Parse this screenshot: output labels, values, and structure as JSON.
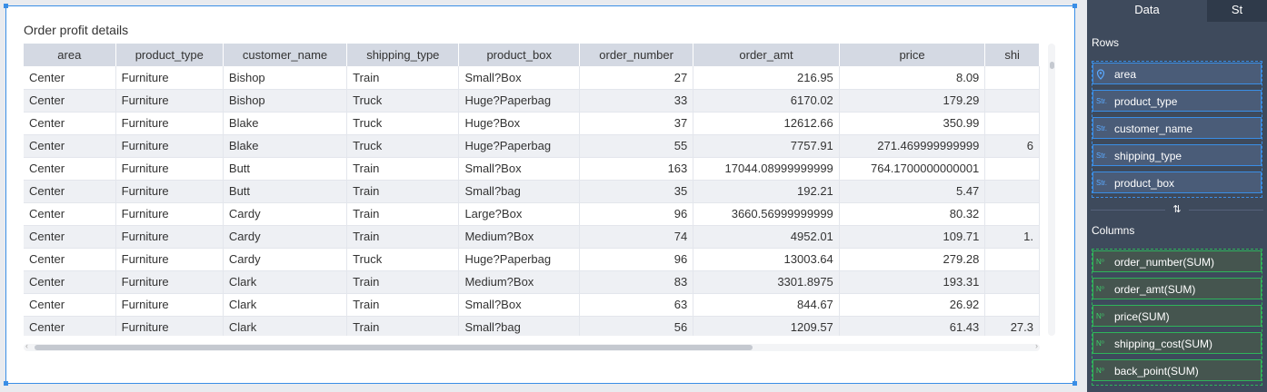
{
  "widget": {
    "title": "Order profit details"
  },
  "table": {
    "columns": [
      "area",
      "product_type",
      "customer_name",
      "shipping_type",
      "product_box",
      "order_number",
      "order_amt",
      "price",
      "shi"
    ],
    "rows": [
      [
        "Center",
        "Furniture",
        "Bishop",
        "Train",
        "Small?Box",
        "27",
        "216.95",
        "8.09",
        ""
      ],
      [
        "Center",
        "Furniture",
        "Bishop",
        "Truck",
        "Huge?Paperbag",
        "33",
        "6170.02",
        "179.29",
        ""
      ],
      [
        "Center",
        "Furniture",
        "Blake",
        "Truck",
        "Huge?Box",
        "37",
        "12612.66",
        "350.99",
        ""
      ],
      [
        "Center",
        "Furniture",
        "Blake",
        "Truck",
        "Huge?Paperbag",
        "55",
        "7757.91",
        "271.469999999999",
        "6"
      ],
      [
        "Center",
        "Furniture",
        "Butt",
        "Train",
        "Small?Box",
        "163",
        "17044.08999999999",
        "764.1700000000001",
        ""
      ],
      [
        "Center",
        "Furniture",
        "Butt",
        "Train",
        "Small?bag",
        "35",
        "192.21",
        "5.47",
        ""
      ],
      [
        "Center",
        "Furniture",
        "Cardy",
        "Train",
        "Large?Box",
        "96",
        "3660.56999999999",
        "80.32",
        ""
      ],
      [
        "Center",
        "Furniture",
        "Cardy",
        "Train",
        "Medium?Box",
        "74",
        "4952.01",
        "109.71",
        "1."
      ],
      [
        "Center",
        "Furniture",
        "Cardy",
        "Truck",
        "Huge?Paperbag",
        "96",
        "13003.64",
        "279.28",
        ""
      ],
      [
        "Center",
        "Furniture",
        "Clark",
        "Train",
        "Medium?Box",
        "83",
        "3301.8975",
        "193.31",
        ""
      ],
      [
        "Center",
        "Furniture",
        "Clark",
        "Train",
        "Small?Box",
        "63",
        "844.67",
        "26.92",
        ""
      ],
      [
        "Center",
        "Furniture",
        "Clark",
        "Train",
        "Small?bag",
        "56",
        "1209.57",
        "61.43",
        "27.3"
      ]
    ]
  },
  "panel": {
    "tabs": {
      "data": "Data",
      "style": "St"
    },
    "rows_label": "Rows",
    "columns_label": "Columns",
    "rows": [
      {
        "label": "area",
        "icon": "location-icon"
      },
      {
        "label": "product_type",
        "icon": "Str."
      },
      {
        "label": "customer_name",
        "icon": "Str."
      },
      {
        "label": "shipping_type",
        "icon": "Str."
      },
      {
        "label": "product_box",
        "icon": "Str."
      }
    ],
    "columns": [
      {
        "label": "order_number(SUM)",
        "icon": "N⁰"
      },
      {
        "label": "order_amt(SUM)",
        "icon": "N⁰"
      },
      {
        "label": "price(SUM)",
        "icon": "N⁰"
      },
      {
        "label": "shipping_cost(SUM)",
        "icon": "N⁰"
      },
      {
        "label": "back_point(SUM)",
        "icon": "N⁰"
      }
    ],
    "swap_icon": "swap-icon"
  },
  "colors": {
    "accent": "#3a8ee6",
    "dimension_field_bg": "#4a5c78",
    "dimension_border": "#3a8ee6",
    "measure_field_bg": "#45554f",
    "measure_border": "#2fb45a",
    "header_bg": "#d4d9e3",
    "panel_bg": "#3e4a5c"
  }
}
